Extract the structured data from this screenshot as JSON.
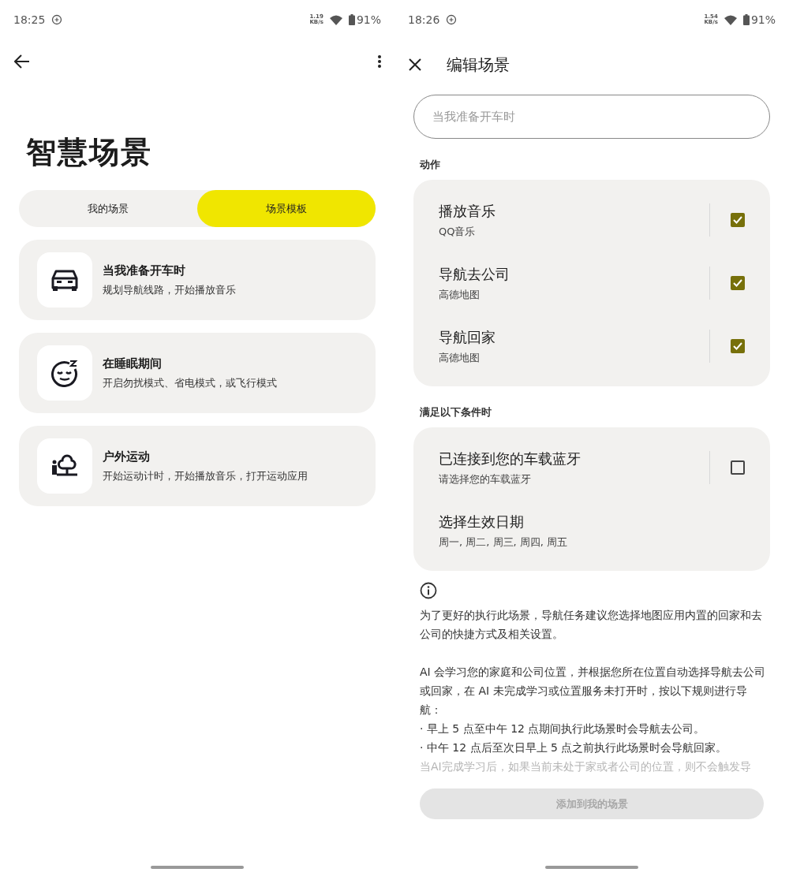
{
  "left_screen": {
    "status_bar": {
      "time": "18:25",
      "net_speed": "1.19",
      "net_unit": "KB/s",
      "battery": "91%"
    },
    "title": "智慧场景",
    "tabs": [
      {
        "label": "我的场景",
        "selected": false
      },
      {
        "label": "场景模板",
        "selected": true
      }
    ],
    "templates": [
      {
        "kind": "car",
        "title": "当我准备开车时",
        "subtitle": "规划导航线路，开始播放音乐"
      },
      {
        "kind": "sleep",
        "title": "在睡眠期间",
        "subtitle": "开启勿扰模式、省电模式，或飞行模式"
      },
      {
        "kind": "outdoor",
        "title": "户外运动",
        "subtitle": "开始运动计时，开始播放音乐，打开运动应用"
      }
    ]
  },
  "right_screen": {
    "status_bar": {
      "time": "18:26",
      "net_speed": "1.54",
      "net_unit": "KB/s",
      "battery": "91%"
    },
    "title": "编辑场景",
    "name_field": {
      "placeholder": "当我准备开车时"
    },
    "actions_label": "动作",
    "actions": [
      {
        "title": "播放音乐",
        "subtitle": "QQ音乐",
        "checked": true
      },
      {
        "title": "导航去公司",
        "subtitle": "高德地图",
        "checked": true
      },
      {
        "title": "导航回家",
        "subtitle": "高德地图",
        "checked": true
      }
    ],
    "conditions_label": "满足以下条件时",
    "conditions": [
      {
        "kind": "checkbox",
        "title": "已连接到您的车载蓝牙",
        "subtitle": "请选择您的车载蓝牙",
        "checked": false
      },
      {
        "kind": "plain",
        "title": "选择生效日期",
        "subtitle": "周一, 周二, 周三, 周四, 周五"
      }
    ],
    "notes": [
      "为了更好的执行此场景，导航任务建议您选择地图应用内置的回家和去公司的快捷方式及相关设置。",
      "AI 会学习您的家庭和公司位置，并根据您所在位置自动选择导航去公司或回家，在 AI 未完成学习或位置服务未打开时，按以下规则进行导航：",
      "· 早上 5 点至中午 12 点期间执行此场景时会导航去公司。",
      "· 中午 12 点后至次日早上 5 点之前执行此场景时会导航回家。",
      "当AI完成学习后，如果当前未处于家或者公司的位置，则不会触发导"
    ],
    "add_button": {
      "label": "添加到我的场景",
      "disabled": true
    }
  }
}
